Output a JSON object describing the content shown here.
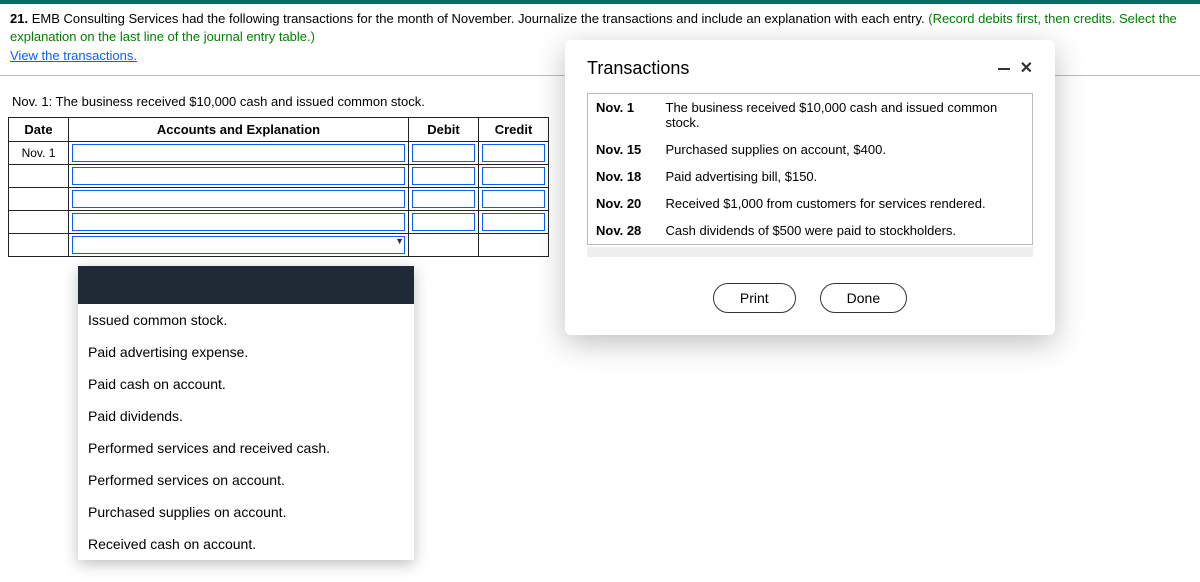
{
  "question": {
    "number": "21.",
    "text_main": " EMB Consulting Services had the following transactions for the month of November. Journalize the transactions and include an explanation with each entry. ",
    "text_instr": "(Record debits first, then credits. Select the explanation on the last line of the journal entry table.)",
    "view_link": "View the transactions."
  },
  "prompt_line": "Nov. 1: The business received $10,000 cash and issued common stock.",
  "journal": {
    "headers": {
      "date": "Date",
      "acct": "Accounts and Explanation",
      "debit": "Debit",
      "credit": "Credit"
    },
    "row_date": "Nov. 1"
  },
  "dropdown": {
    "options": [
      "",
      "Issued common stock.",
      "Paid advertising expense.",
      "Paid cash on account.",
      "Paid dividends.",
      "Performed services and received cash.",
      "Performed services on account.",
      "Purchased supplies on account.",
      "Received cash on account."
    ]
  },
  "modal": {
    "title": "Transactions",
    "rows": [
      {
        "date": "Nov. 1",
        "desc": "The business received $10,000 cash and issued common stock."
      },
      {
        "date": "Nov. 15",
        "desc": "Purchased supplies on account, $400."
      },
      {
        "date": "Nov. 18",
        "desc": "Paid advertising bill, $150."
      },
      {
        "date": "Nov. 20",
        "desc": "Received $1,000 from customers for services rendered."
      },
      {
        "date": "Nov. 28",
        "desc": "Cash dividends of $500 were paid to stockholders."
      }
    ],
    "print_label": "Print",
    "done_label": "Done"
  }
}
